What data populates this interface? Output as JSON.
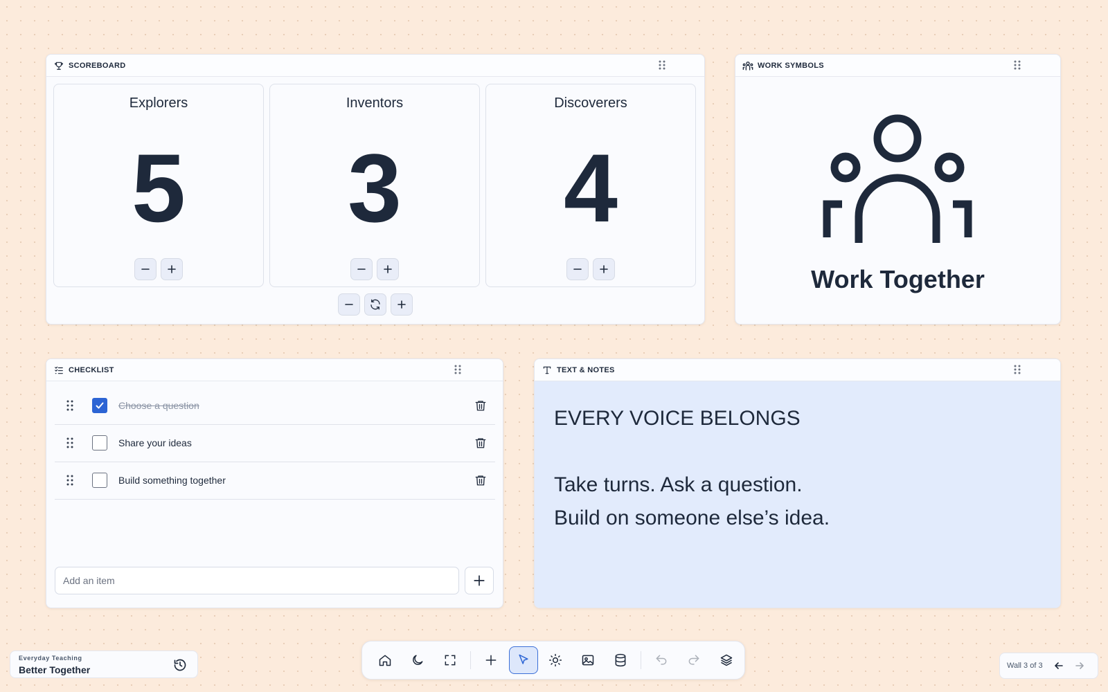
{
  "scoreboard": {
    "title": "SCOREBOARD",
    "teams": [
      {
        "name": "Explorers",
        "score": "5"
      },
      {
        "name": "Inventors",
        "score": "3"
      },
      {
        "name": "Discoverers",
        "score": "4"
      }
    ],
    "icons": {
      "header": "trophy-icon",
      "decrement": "minus-icon",
      "increment": "plus-icon",
      "reset": "refresh-icon",
      "drag": "grip-icon"
    }
  },
  "work_symbols": {
    "title": "WORK SYMBOLS",
    "symbol_icon": "work-together-people-icon",
    "label": "Work Together"
  },
  "checklist": {
    "title": "CHECKLIST",
    "items": [
      {
        "text": "Choose a question",
        "checked": true
      },
      {
        "text": "Share your ideas",
        "checked": false
      },
      {
        "text": "Build something together",
        "checked": false
      }
    ],
    "input_placeholder": "Add an item",
    "input_value": "",
    "icons": {
      "header": "checklist-icon",
      "drag": "drag-handle-icon",
      "delete": "trash-icon",
      "add": "plus-icon"
    }
  },
  "notes": {
    "title": "TEXT & NOTES",
    "lines": [
      "EVERY VOICE BELONGS",
      "",
      "Take turns. Ask a question.",
      "Build on someone else’s idea."
    ],
    "background": "#e2ebfc"
  },
  "wall": {
    "subtitle": "Everyday Teaching",
    "title": "Better Together",
    "history_icon": "history-icon"
  },
  "toolbar": {
    "buttons": [
      "home-icon",
      "moon-icon",
      "fullscreen-icon",
      "plus-icon",
      "pointer-icon",
      "brightness-icon",
      "image-icon",
      "database-icon",
      "undo-icon",
      "redo-icon",
      "layers-icon"
    ],
    "active": "pointer-icon"
  },
  "wall_nav": {
    "label": "Wall 3 of 3"
  },
  "colors": {
    "background": "#fcebdc",
    "accent": "#2c64d4",
    "text": "#1e293b"
  }
}
